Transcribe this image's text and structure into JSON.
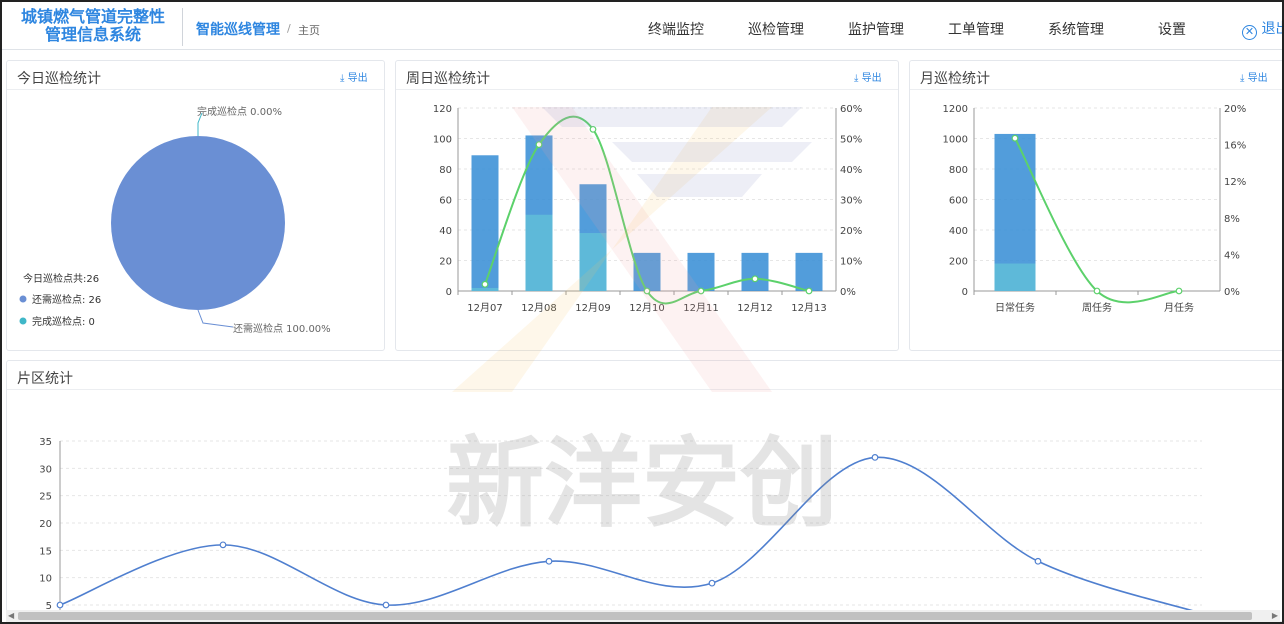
{
  "header": {
    "app_title_line1": "城镇燃气管道完整性",
    "app_title_line2": "管理信息系统",
    "module_title": "智能巡线管理",
    "crumb_sep": "/",
    "breadcrumb": "主页",
    "nav": [
      "终端监控",
      "巡检管理",
      "监护管理",
      "工单管理",
      "系统管理",
      "设置"
    ],
    "logout_label": "退出",
    "logout_icon": "close-circle-icon"
  },
  "export_label": "导出",
  "export_icon": "download-icon",
  "panels": {
    "today": {
      "title": "今日巡检统计",
      "total_label": "今日巡检点共:26",
      "legend": [
        {
          "label": "还需巡检点: 26",
          "color": "#6a8fd4"
        },
        {
          "label": "完成巡检点: 0",
          "color": "#3fb7c8"
        }
      ],
      "callout_done": "完成巡检点 0.00%",
      "callout_remaining": "还需巡检点 100.00%"
    },
    "week": {
      "title": "周日巡检统计"
    },
    "month": {
      "title": "月巡检统计"
    },
    "district": {
      "title": "片区统计"
    }
  },
  "watermark": {
    "text": "新洋安创"
  },
  "chart_data": [
    {
      "type": "pie",
      "title": "今日巡检统计",
      "labels": [
        "还需巡检点",
        "完成巡检点"
      ],
      "values": [
        26,
        0
      ],
      "colors": [
        "#6a8fd4",
        "#3fb7c8"
      ]
    },
    {
      "type": "bar",
      "title": "周日巡检统计",
      "categories": [
        "12月07",
        "12月08",
        "12月09",
        "12月10",
        "12月11",
        "12月12",
        "12月13"
      ],
      "series": [
        {
          "kind": "bar",
          "values": [
            89,
            102,
            70,
            25,
            25,
            25,
            25
          ],
          "color": "#3a8fd6"
        },
        {
          "kind": "bar",
          "values": [
            2,
            50,
            38,
            0,
            0,
            0,
            0
          ],
          "color": "#62c1d8"
        },
        {
          "kind": "line",
          "axis": "right",
          "values": [
            2.2,
            48,
            53,
            0,
            0,
            4,
            0
          ],
          "color": "#5cd16b"
        }
      ],
      "ylim": [
        0,
        120
      ],
      "yticks": [
        0,
        20,
        40,
        60,
        80,
        100,
        120
      ],
      "y2lim": [
        0,
        60
      ],
      "y2ticks": [
        "0%",
        "10%",
        "20%",
        "30%",
        "40%",
        "50%",
        "60%"
      ]
    },
    {
      "type": "bar",
      "title": "月巡检统计",
      "categories": [
        "日常任务",
        "周任务",
        "月任务"
      ],
      "series": [
        {
          "kind": "bar",
          "values": [
            1030,
            0,
            0
          ],
          "color": "#3a8fd6"
        },
        {
          "kind": "bar",
          "values": [
            180,
            0,
            0
          ],
          "color": "#62c1d8"
        },
        {
          "kind": "line",
          "axis": "right",
          "values": [
            16.7,
            0,
            0
          ],
          "color": "#5cd16b"
        }
      ],
      "ylim": [
        0,
        1200
      ],
      "yticks": [
        0,
        200,
        400,
        600,
        800,
        1000,
        1200
      ],
      "y2lim": [
        0,
        20
      ],
      "y2ticks": [
        "0%",
        "4%",
        "8%",
        "12%",
        "16%",
        "20%"
      ]
    },
    {
      "type": "line",
      "title": "片区统计",
      "series": [
        {
          "values": [
            5,
            16,
            5,
            13,
            9,
            32,
            13,
            3.5
          ],
          "color": "#4f7fcf"
        }
      ],
      "ylim": [
        5,
        35
      ],
      "yticks": [
        5,
        10,
        15,
        20,
        25,
        30,
        35
      ]
    }
  ]
}
